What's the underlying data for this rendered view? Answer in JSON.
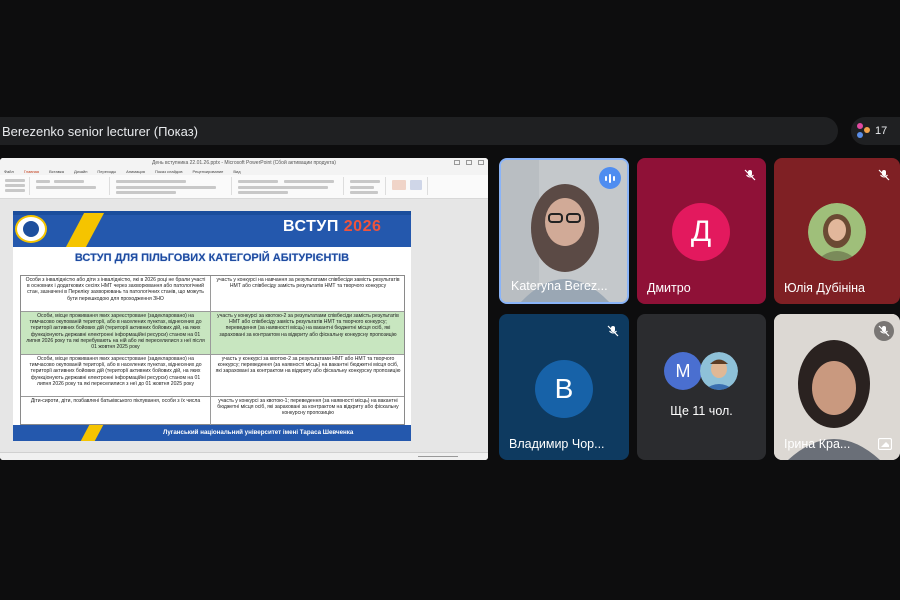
{
  "meeting": {
    "presenter_title": "Berezenko senior lecturer (Показ)",
    "participant_count": "17"
  },
  "window": {
    "title": "День вступника 22.01.26.pptx - Microsoft PowerPoint (Сбой активации продукта)"
  },
  "ribbon": {
    "tabs": [
      "Файл",
      "Главная",
      "Вставка",
      "Дизайн",
      "Переходы",
      "Анимация",
      "Показ слайдов",
      "Рецензирование",
      "Вид"
    ],
    "active_tab": 1
  },
  "slide": {
    "banner": "ВСТУП",
    "banner_year": "2026",
    "title": "ВСТУП ДЛЯ ПІЛЬГОВИХ КАТЕГОРІЙ АБІТУРІЄНТІВ",
    "rows": [
      {
        "left": "Особи з інвалідністю або діти з інвалідністю, які в 2026 році не брали участі в основних і додаткових сесіях НМТ через захворювання або патологічний стан, зазначені в Переліку захворювань та патологічних станів, що можуть бути перешкодою для проходження ЗНО",
        "right": "участь у конкурсі на навчання за результатами співбесіди замість результатів НМТ або співбесіду замість результатів НМТ та творчого конкурсу"
      },
      {
        "left": "Особи, місце проживання яких зареєстроване (задекларовано) на тимчасово окупованій території, або в населених пунктах, віднесених до території активних бойових дій (території активних бойових дій, на яких функціонують державні електронні інформаційні ресурси) станом на 01 липня 2026 року та які перебувають на ній або які переселилися з неї після 01 жовтня 2025 року",
        "right": "участь у конкурсі за квотою-2 за результатами співбесіди замість результатів НМТ або співбесіду замість результатів НМТ та творчого конкурсу; переведення (за наявності місць) на вакантні бюджетні місця осіб, які зараховані за контрактом на відкриту або фіскальну конкурсну пропозицію"
      },
      {
        "left": "Особи, місце проживання яких зареєстроване (задекларовано) на тимчасово окупованій території, або в населених пунктах, віднесених до території активних бойових дій (території активних бойових дій, на яких функціонують державні електронні інформаційні ресурси) станом на 01 липня 2026 року та які переселилися з неї до 01 жовтня 2025 року",
        "right": "участь у конкурсі за квотою-2 за результатами НМТ або НМТ та творчого конкурсу; переведення (за наявності місць) на вакантні бюджетні місця осіб, які зараховані за контрактом на відкриту або фіскальну конкурсну пропозицію"
      },
      {
        "left": "Діти-сироти, діти, позбавлені батьківського піклування, особи з їх числа",
        "right": "участь у конкурсі за квотою-1; переведення (за наявності місць) на вакантні бюджетні місця осіб, які зараховані за контрактом на відкриту або фіскальну конкурсну пропозицію"
      }
    ],
    "footer": "Луганський національний університет імені Тараса Шевченка"
  },
  "tiles": [
    {
      "name": "Kateryna Berez...",
      "kind": "video",
      "state": "speaking"
    },
    {
      "name": "Дмитро",
      "kind": "initial",
      "initial": "Д",
      "state": "muted",
      "bg": "#8f1137",
      "avatar_bg": "#e3195e"
    },
    {
      "name": "Юлія Дубініна",
      "kind": "photo",
      "state": "muted",
      "bg": "#7f2024"
    },
    {
      "name": "Владимир Чор...",
      "kind": "initial",
      "initial": "В",
      "state": "muted",
      "bg": "#0e3a60",
      "avatar_bg": "#1762a8"
    },
    {
      "name": "Ще 11 чол.",
      "kind": "group",
      "initial": "М",
      "state": "none",
      "bg": "#2b2c2f",
      "avatar_bg": "#4a6fd0"
    },
    {
      "name": "Ірина Кра...",
      "kind": "video",
      "state": "muted"
    }
  ],
  "colors": {
    "accent_blue": "#2458ad",
    "accent_yellow": "#f5c400",
    "year_red": "#f0543c",
    "speaking_blue": "#4f8df0"
  }
}
